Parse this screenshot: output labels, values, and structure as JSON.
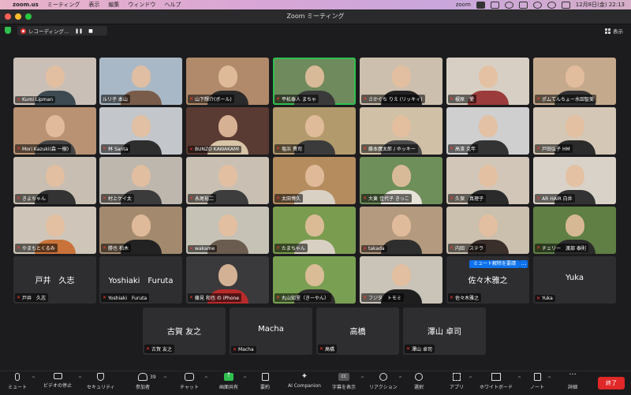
{
  "menubar": {
    "app": "zoom.us",
    "items": [
      "ミーティング",
      "表示",
      "編集",
      "ウィンドウ",
      "ヘルプ"
    ],
    "status_app": "zoom",
    "datetime": "12月8日(金)  22:13"
  },
  "window": {
    "title": "Zoom ミーティング"
  },
  "recording": {
    "label": "レコーディング...",
    "pause": "❚❚",
    "stop": "■"
  },
  "view_button": {
    "label": "表示"
  },
  "participants": [
    {
      "name": "Kumi Lipman",
      "muted": true
    },
    {
      "name": "ルリ子 本山",
      "muted": false
    },
    {
      "name": "山下輝介(ボール)",
      "muted": true
    },
    {
      "name": "平松泰人 まちゃ",
      "muted": true
    },
    {
      "name": "さかぐち りえ (リッキィ)",
      "muted": true
    },
    {
      "name": "榎原　愛",
      "muted": true
    },
    {
      "name": "ポムてんちょー水田智美",
      "muted": true
    },
    {
      "name": "Mori Kazuki(森 一樹)",
      "muted": true
    },
    {
      "name": "林 Santa",
      "muted": true
    },
    {
      "name": "BUNZO KAWAKAMI",
      "muted": true
    },
    {
      "name": "塩浜 貴司",
      "muted": true
    },
    {
      "name": "藤本廣太郎 / ホッキー",
      "muted": true
    },
    {
      "name": "高濱 克年",
      "muted": true
    },
    {
      "name": "戸田弘子 HM",
      "muted": true
    },
    {
      "name": "きよちゃん",
      "muted": true
    },
    {
      "name": "村上ケイ太",
      "muted": true
    },
    {
      "name": "永尾裕二",
      "muted": true
    },
    {
      "name": "太田博久",
      "muted": true
    },
    {
      "name": "大東 佳代子 きっこ",
      "muted": true
    },
    {
      "name": "久保　真理子",
      "muted": true
    },
    {
      "name": "AR HAIR 白井",
      "muted": true
    },
    {
      "name": "やまもとくるみ",
      "muted": true
    },
    {
      "name": "勝也 柏木",
      "muted": true
    },
    {
      "name": "wakame",
      "muted": true
    },
    {
      "name": "たまちゃん",
      "muted": true
    },
    {
      "name": "takada",
      "muted": true
    },
    {
      "name": "内田　ステラ",
      "muted": true
    },
    {
      "name": "チェリー　渡部 泰則",
      "muted": true
    },
    {
      "name": "戸井　久志",
      "muted": true
    },
    {
      "name": "Yoshiaki　Furuta",
      "muted": true
    },
    {
      "name": "藤見 和也 の iPhone",
      "muted": true
    },
    {
      "name": "丸山知里（きーやん）",
      "muted": true
    },
    {
      "name": "フジタ　トモミ",
      "muted": true
    },
    {
      "name": "佐々木雅之",
      "muted": true
    },
    {
      "name": "Yuka",
      "muted": true
    },
    {
      "name": "古賀 友之",
      "muted": true
    },
    {
      "name": "Macha",
      "muted": true
    },
    {
      "name": "高橋",
      "muted": true
    },
    {
      "name": "澤山 卓司",
      "muted": true
    }
  ],
  "big_names": {
    "p28": "戸井　久志",
    "p29": "Yoshiaki　Furuta",
    "p33": "佐々木雅之",
    "p34": "Yuka",
    "p35": "古賀 友之",
    "p36": "Macha",
    "p37": "高橋",
    "p38": "澤山 卓司"
  },
  "unmute_request": "ミュート解除を要請",
  "toolbar": {
    "mute": "ミュート",
    "video": "ビデオの停止",
    "security": "セキュリティ",
    "participants": "参加者",
    "participants_count": "39",
    "chat": "チャット",
    "share": "画面共有",
    "summary": "要約",
    "ai": "AI Companion",
    "captions": "字幕を表示",
    "captions_icon": "CC",
    "reactions": "リアクション",
    "select": "選択",
    "apps": "アプリ",
    "whiteboard": "ホワイトボード",
    "notes": "ノート",
    "details": "詳細",
    "end": "終了"
  },
  "colors": {
    "end": "#e02828",
    "share": "#2fbf4f",
    "unmute": "#0e72ed",
    "mute_icon": "#ff3b30"
  }
}
